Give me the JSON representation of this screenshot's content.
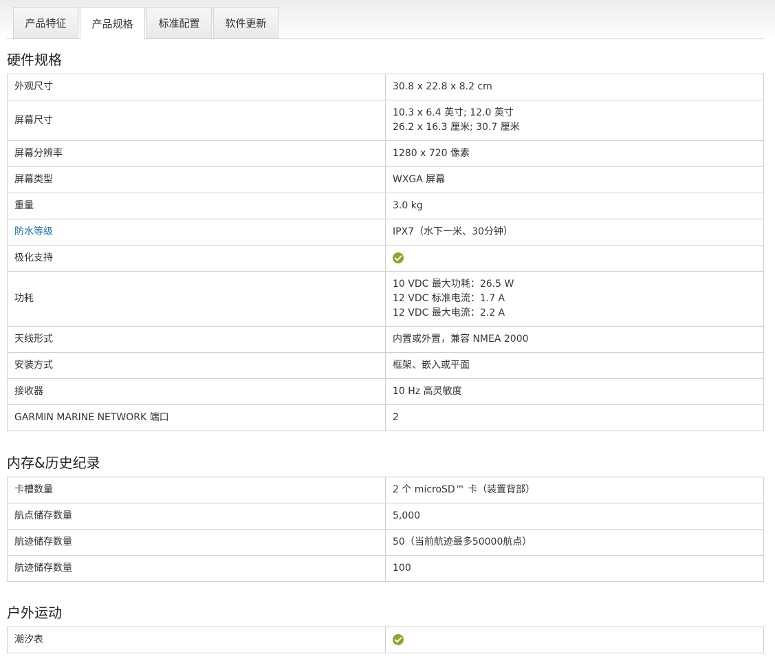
{
  "tabs": [
    "产品特征",
    "产品规格",
    "标准配置",
    "软件更新"
  ],
  "active_tab": "产品规格",
  "sections": [
    {
      "title": "硬件规格",
      "rows": [
        {
          "label": "外观尺寸",
          "value": [
            "30.8 x 22.8 x 8.2 cm"
          ]
        },
        {
          "label": "屏幕尺寸",
          "value": [
            "10.3 x 6.4 英寸; 12.0 英寸",
            "26.2 x 16.3 厘米; 30.7 厘米"
          ]
        },
        {
          "label": "屏幕分辨率",
          "value": [
            "1280 x 720 像素"
          ]
        },
        {
          "label": "屏幕类型",
          "value": [
            "WXGA 屏幕"
          ]
        },
        {
          "label": "重量",
          "value": [
            "3.0 kg"
          ]
        },
        {
          "label": "防水等级",
          "label_is_link": true,
          "value": [
            "IPX7（水下一米、30分钟）"
          ]
        },
        {
          "label": "极化支持",
          "check": true
        },
        {
          "label": "功耗",
          "value": [
            "10 VDC 最大功耗：26.5 W",
            "12 VDC 标准电流：1.7 A",
            "12 VDC 最大电流：2.2 A"
          ]
        },
        {
          "label": "天线形式",
          "value": [
            "内置或外置，兼容 NMEA 2000"
          ]
        },
        {
          "label": "安装方式",
          "value": [
            "框架、嵌入或平面"
          ]
        },
        {
          "label": "接收器",
          "value": [
            "10 Hz 高灵敏度"
          ]
        },
        {
          "label": "GARMIN MARINE NETWORK 端口",
          "value": [
            "2"
          ]
        }
      ]
    },
    {
      "title": "内存&历史纪录",
      "rows": [
        {
          "label": "卡槽数量",
          "value": [
            "2 个 microSD™ 卡（装置背部）"
          ]
        },
        {
          "label": "航点储存数量",
          "value": [
            "5,000"
          ]
        },
        {
          "label": "航迹储存数量",
          "value": [
            "50（当前航迹最多50000航点）"
          ]
        },
        {
          "label": "航迹储存数量",
          "value": [
            "100"
          ]
        }
      ]
    },
    {
      "title": "户外运动",
      "rows": [
        {
          "label": "潮汐表",
          "check": true
        }
      ]
    }
  ],
  "colors": {
    "check": "#8ea52a",
    "link": "#1a73b5",
    "border": "#d0d0d0"
  },
  "icons": {
    "check": "checkmark-icon"
  }
}
